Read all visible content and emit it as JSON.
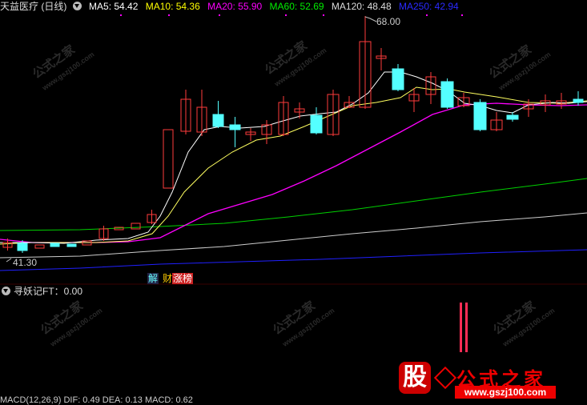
{
  "header": {
    "stock_name": "天益医疗 (日线)",
    "ma": [
      {
        "label": "MA5: 54.42",
        "color": "#ffffff"
      },
      {
        "label": "MA10: 54.36",
        "color": "#ffff00"
      },
      {
        "label": "MA20: 55.90",
        "color": "#ff00ff"
      },
      {
        "label": "MA60: 52.69",
        "color": "#00e000"
      },
      {
        "label": "MA120: 48.48",
        "color": "#dddddd"
      },
      {
        "label": "MA250: 42.94",
        "color": "#2020ff"
      }
    ]
  },
  "price_labels": {
    "high": "68.00",
    "low": "41.30"
  },
  "badges": {
    "jie": "解",
    "cai": "财",
    "zhangbang": "涨榜"
  },
  "indicator": {
    "title": "寻妖记FT：0.00"
  },
  "macd_row": {
    "text": "MACD(12,26,9) DIF: 0.49 DEA: 0.13 MACD: 0.62"
  },
  "watermark": {
    "line1": "公式之家",
    "line2": "www.gszj100.com"
  },
  "logo": {
    "gu": "股",
    "name": "公式之家",
    "url": "www.gszj100.com"
  },
  "colors": {
    "up": "#ff3b3b",
    "down": "#54ffff",
    "background": "#000000"
  }
}
